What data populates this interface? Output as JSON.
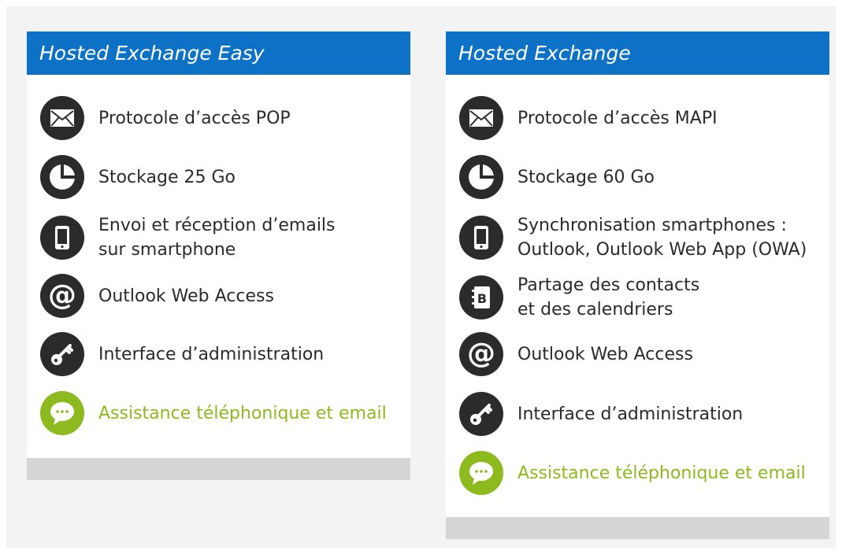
{
  "colors": {
    "header_blue": "#0d72c5",
    "icon_dark": "#2b2b2b",
    "accent_green": "#8dba1e",
    "page_background": "#f3f3f3",
    "footer_gray": "#d6d6d6"
  },
  "plans": [
    {
      "title": "Hosted Exchange Easy",
      "features": [
        {
          "icon": "envelope-icon",
          "label": "Protocole d’accès POP"
        },
        {
          "icon": "pie-chart-icon",
          "label": "Stockage 25 Go"
        },
        {
          "icon": "smartphone-icon",
          "label": "Envoi et réception d’emails\nsur smartphone"
        },
        {
          "icon": "at-sign-icon",
          "label": "Outlook Web Access"
        },
        {
          "icon": "key-icon",
          "label": "Interface d’administration"
        },
        {
          "icon": "chat-bubble-icon",
          "label": "Assistance téléphonique et email"
        }
      ]
    },
    {
      "title": "Hosted Exchange",
      "features": [
        {
          "icon": "envelope-icon",
          "label": "Protocole d’accès MAPI"
        },
        {
          "icon": "pie-chart-icon",
          "label": "Stockage 60 Go"
        },
        {
          "icon": "smartphone-icon",
          "label": "Synchronisation smartphones :\nOutlook, Outlook Web App (OWA)"
        },
        {
          "icon": "address-book-icon",
          "label": "Partage des contacts\net des calendriers"
        },
        {
          "icon": "at-sign-icon",
          "label": "Outlook Web Access"
        },
        {
          "icon": "key-icon",
          "label": "Interface d’administration"
        },
        {
          "icon": "chat-bubble-icon",
          "label": "Assistance téléphonique et email"
        }
      ]
    }
  ]
}
